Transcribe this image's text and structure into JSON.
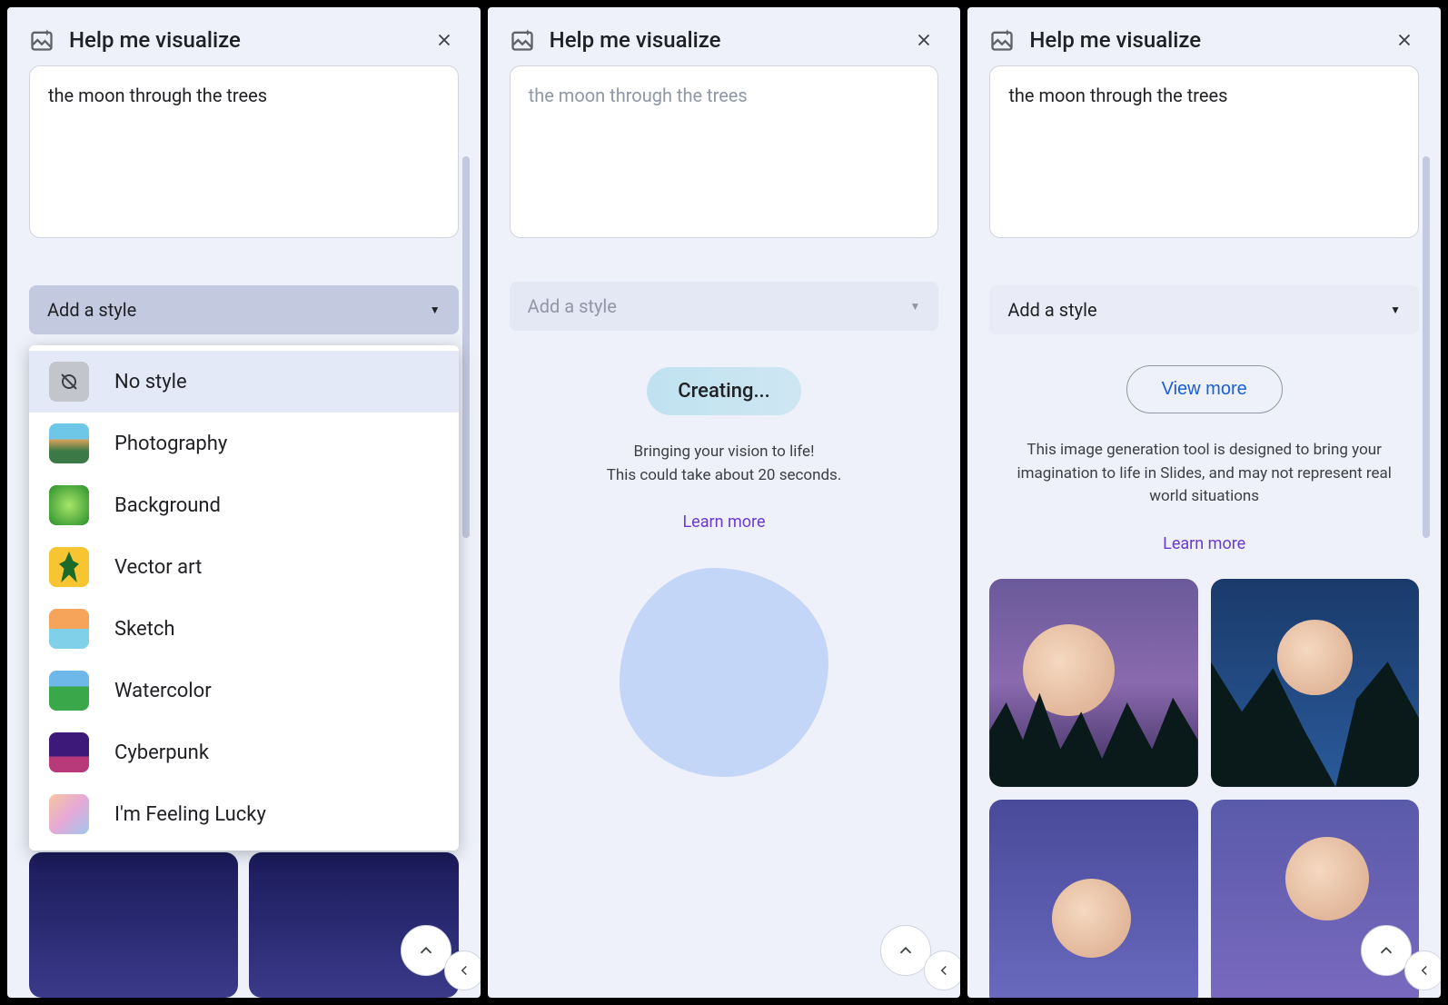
{
  "header": {
    "title": "Help me visualize"
  },
  "prompt": {
    "text": "the moon through the trees"
  },
  "styleSelect": {
    "placeholder": "Add a style"
  },
  "styleOptions": [
    {
      "label": "No style"
    },
    {
      "label": "Photography"
    },
    {
      "label": "Background"
    },
    {
      "label": "Vector art"
    },
    {
      "label": "Sketch"
    },
    {
      "label": "Watercolor"
    },
    {
      "label": "Cyberpunk"
    },
    {
      "label": "I'm Feeling Lucky"
    }
  ],
  "loading": {
    "pill": "Creating...",
    "line1": "Bringing your vision to life!",
    "line2": "This could take about 20 seconds.",
    "learnMore": "Learn more"
  },
  "results": {
    "viewMore": "View more",
    "disclaimer": "This image generation tool is designed to bring your imagination to life in Slides, and may not represent real world situations",
    "learnMore": "Learn more"
  }
}
